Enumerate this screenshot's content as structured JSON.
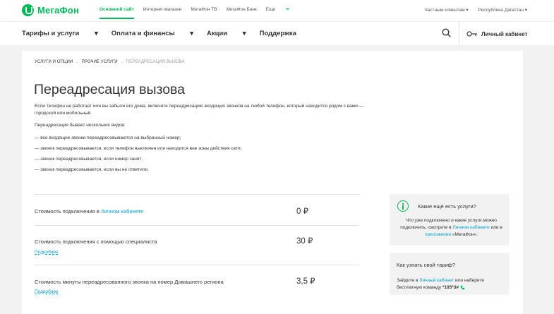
{
  "brand": {
    "name": "МегаФон",
    "color": "#00b956"
  },
  "topbar": {
    "links": [
      "Основной сайт",
      "Интернет-магазин",
      "МегаФон ТВ",
      "МегаФон Банк",
      "Еще"
    ],
    "more_dots": "•••",
    "client_type": "Частным клиентам",
    "region": "Республика Дагестан"
  },
  "nav": {
    "items": [
      "Тарифы и услуги",
      "Оплата и финансы",
      "Акции",
      "Поддержка"
    ],
    "account_label": "Личный кабинет"
  },
  "breadcrumb": {
    "items": [
      "Услуги и опции",
      "Прочие услуги",
      "Переадресация вызова"
    ]
  },
  "page": {
    "title": "Переадресация вызова",
    "intro": "Если телефон не работает или вы забыли его дома, включите переадресацию входящих звонков на любой телефон, который находится рядом с вами — городской или мобильный.",
    "types_title": "Переадресация бывает нескольких видов:",
    "types": [
      "—  все входящие звонки переадресовываются на выбранный номер;",
      "—  звонок переадресовывается, если телефон выключен или находится вне зоны действия сети;",
      "—  звонок переадресовывается, если номер занят;",
      "—  звонок переадресовывается, если вы не ответили."
    ]
  },
  "prices": [
    {
      "label": "Стоимость подключения в ",
      "link": "Личном кабинете",
      "price": "0 ₽",
      "more": ""
    },
    {
      "label": "Стоимость подключения с помощью специалиста",
      "link": "",
      "price": "30 ₽",
      "more": "Подробнее"
    },
    {
      "label": "Стоимость минуты переадресованного звонка на номер Домашнего региона",
      "link": "",
      "price": "3,5 ₽",
      "more": "Подробнее"
    }
  ],
  "sidebar": {
    "services": {
      "title": "Какие ещё есть услуги?",
      "text_before": "Что уже подключено и какие услуги можно подключить, смотрите в ",
      "link1": "Личном кабинете",
      "text_mid": " или в ",
      "link2": "приложении",
      "text_after": " «МегаФон»."
    },
    "tariff": {
      "title": "Как узнать свой тариф?",
      "text_before": "Зайдите в ",
      "link": "Личный кабинет",
      "text_after": " или наберите бесплатную команду ",
      "command": "*105*3#"
    }
  }
}
